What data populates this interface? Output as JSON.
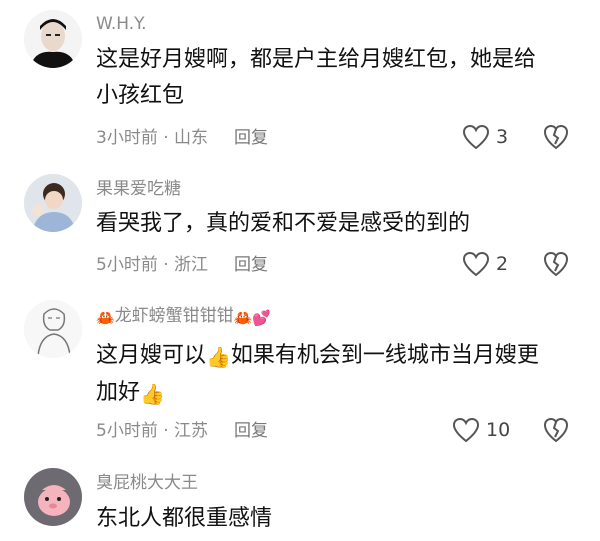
{
  "comments": [
    {
      "username": "W.H.Y.",
      "text_line1": "这是好月嫂啊，都是户主给月嫂红包，她是给",
      "text_line2": "小孩红包",
      "time": "3小时前",
      "location": "山东",
      "reply_label": "回复",
      "likes": "3"
    },
    {
      "username": "果果爱吃糖",
      "text_line1": "看哭我了，真的爱和不爱是感受的到的",
      "time": "5小时前",
      "location": "浙江",
      "reply_label": "回复",
      "likes": "2"
    },
    {
      "username_prefix_emoji": "🦀",
      "username": "龙虾螃蟹钳钳钳",
      "username_suffix_emoji": "🦀💕",
      "text_line1": "这月嫂可以",
      "emoji_a": "👍",
      "text_line1b": "如果有机会到一线城市当月嫂更",
      "text_line2": "加好",
      "emoji_b": "👍",
      "time": "5小时前",
      "location": "江苏",
      "reply_label": "回复",
      "likes": "10"
    },
    {
      "username": "臭屁桃大大王",
      "text_line1": "东北人都很重感情"
    }
  ],
  "separator": " · ",
  "colors": {
    "meta": "#8a8a8a",
    "text": "#111111",
    "icon": "#555555"
  },
  "icons": {
    "like": "heart-outline-icon",
    "dislike": "broken-heart-icon"
  }
}
